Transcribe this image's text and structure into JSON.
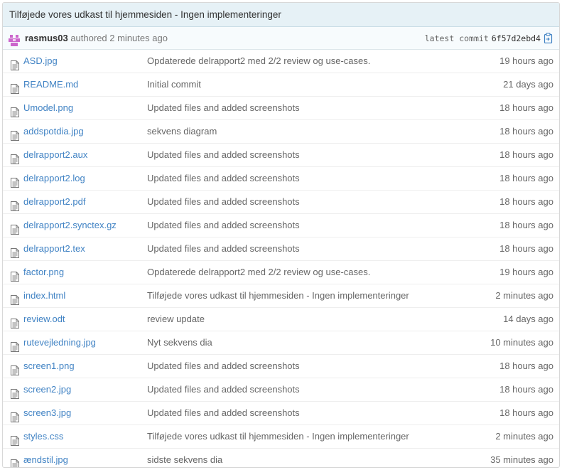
{
  "commit": {
    "title": "Tilføjede vores udkast til hjemmesiden - Ingen implementeringer",
    "author": "rasmus03",
    "authored_text": " authored 2 minutes ago",
    "latest_label": "latest commit",
    "sha": "6f57d2ebd4",
    "avatar_color": "#cc66cc"
  },
  "colors": {
    "link": "#4183c4",
    "header_bg": "#e6f1f6",
    "meta_bg": "#f7fbfd"
  },
  "files": [
    {
      "name": "ASD.jpg",
      "message": "Opdaterede delrapport2 med 2/2 review og use-cases.",
      "age": "19 hours ago",
      "icon": "file-icon"
    },
    {
      "name": "README.md",
      "message": "Initial commit",
      "age": "21 days ago",
      "icon": "file-icon"
    },
    {
      "name": "Umodel.png",
      "message": "Updated files and added screenshots",
      "age": "18 hours ago",
      "icon": "file-icon"
    },
    {
      "name": "addspotdia.jpg",
      "message": "sekvens diagram",
      "age": "18 hours ago",
      "icon": "file-icon"
    },
    {
      "name": "delrapport2.aux",
      "message": "Updated files and added screenshots",
      "age": "18 hours ago",
      "icon": "file-icon"
    },
    {
      "name": "delrapport2.log",
      "message": "Updated files and added screenshots",
      "age": "18 hours ago",
      "icon": "file-icon"
    },
    {
      "name": "delrapport2.pdf",
      "message": "Updated files and added screenshots",
      "age": "18 hours ago",
      "icon": "file-icon"
    },
    {
      "name": "delrapport2.synctex.gz",
      "message": "Updated files and added screenshots",
      "age": "18 hours ago",
      "icon": "file-icon"
    },
    {
      "name": "delrapport2.tex",
      "message": "Updated files and added screenshots",
      "age": "18 hours ago",
      "icon": "file-icon"
    },
    {
      "name": "factor.png",
      "message": "Opdaterede delrapport2 med 2/2 review og use-cases.",
      "age": "19 hours ago",
      "icon": "file-icon"
    },
    {
      "name": "index.html",
      "message": "Tilføjede vores udkast til hjemmesiden - Ingen implementeringer",
      "age": "2 minutes ago",
      "icon": "file-icon"
    },
    {
      "name": "review.odt",
      "message": "review update",
      "age": "14 days ago",
      "icon": "file-icon"
    },
    {
      "name": "rutevejledning.jpg",
      "message": "Nyt sekvens dia",
      "age": "10 minutes ago",
      "icon": "file-icon"
    },
    {
      "name": "screen1.png",
      "message": "Updated files and added screenshots",
      "age": "18 hours ago",
      "icon": "file-icon"
    },
    {
      "name": "screen2.jpg",
      "message": "Updated files and added screenshots",
      "age": "18 hours ago",
      "icon": "file-icon"
    },
    {
      "name": "screen3.jpg",
      "message": "Updated files and added screenshots",
      "age": "18 hours ago",
      "icon": "file-icon"
    },
    {
      "name": "styles.css",
      "message": "Tilføjede vores udkast til hjemmesiden - Ingen implementeringer",
      "age": "2 minutes ago",
      "icon": "file-icon"
    },
    {
      "name": "ændstil.jpg",
      "message": "sidste sekvens dia",
      "age": "35 minutes ago",
      "icon": "file-icon"
    }
  ]
}
